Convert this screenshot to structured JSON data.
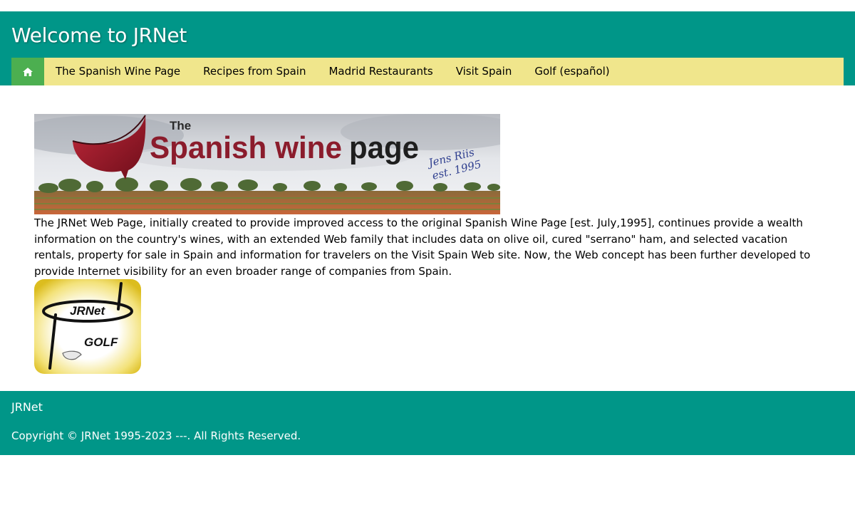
{
  "header": {
    "title": "Welcome to JRNet"
  },
  "nav": {
    "home_icon": "home-icon",
    "items": [
      {
        "label": "The Spanish Wine Page"
      },
      {
        "label": "Recipes from Spain"
      },
      {
        "label": "Madrid Restaurants"
      },
      {
        "label": "Visit Spain"
      },
      {
        "label": "Golf (español)"
      }
    ]
  },
  "banner": {
    "the_word": "The",
    "title_part1": "Spanish wine",
    "title_part2": "page",
    "signature": "Jens Riis",
    "established": "est. 1995"
  },
  "main": {
    "intro": "The JRNet Web Page, initially created to provide improved access to the original Spanish Wine Page [est. July,1995], continues provide a wealth information on the country's wines, with an extended Web family that includes data on olive oil, cured \"serrano\" ham, and selected vacation rentals, property for sale in Spain and information for travelers on the Visit Spain Web site. Now, the Web concept has been further developed to provide Internet visibility for an even broader range of companies from Spain."
  },
  "golf_logo": {
    "line1": "JRNet",
    "line2": "GOLF"
  },
  "footer": {
    "brand": "JRNet",
    "copyright": "Copyright © JRNet 1995-2023 ---. All Rights Reserved."
  },
  "colors": {
    "header": "#009688",
    "navbar": "#f0e68c",
    "home_button": "#4caf50",
    "wine_red": "#8b1c2c",
    "golf_yellow": "#e6c730"
  }
}
